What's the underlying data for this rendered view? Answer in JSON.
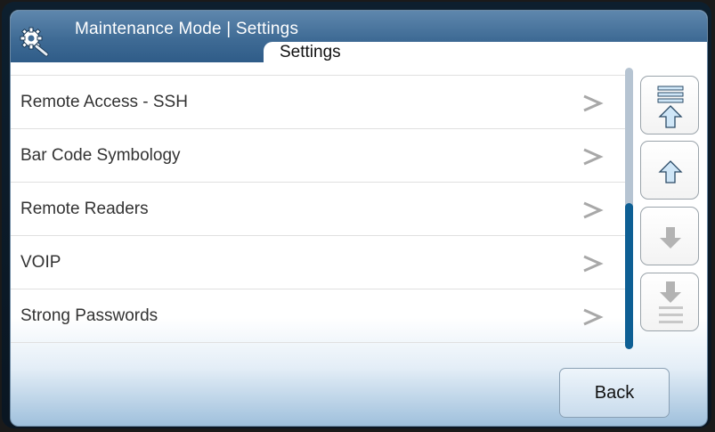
{
  "header": {
    "title": "Maintenance Mode | Settings",
    "tab_label": "Settings",
    "icon": "gear-wrench-icon"
  },
  "list": {
    "items": [
      {
        "label": "Remote Access - SSH",
        "icon": "chevron-right-icon"
      },
      {
        "label": "Bar Code Symbology",
        "icon": "chevron-right-icon"
      },
      {
        "label": "Remote Readers",
        "icon": "chevron-right-icon"
      },
      {
        "label": "VOIP",
        "icon": "chevron-right-icon"
      },
      {
        "label": "Strong Passwords",
        "icon": "chevron-right-icon"
      }
    ]
  },
  "scroll": {
    "position_fraction": 0.52,
    "buttons": [
      {
        "name": "scroll-top-button",
        "icon": "arrow-up-to-top-icon",
        "enabled": true
      },
      {
        "name": "scroll-up-button",
        "icon": "arrow-up-icon",
        "enabled": true
      },
      {
        "name": "scroll-down-button",
        "icon": "arrow-down-icon",
        "enabled": false
      },
      {
        "name": "scroll-bottom-button",
        "icon": "arrow-down-to-bottom-icon",
        "enabled": false
      }
    ]
  },
  "footer": {
    "back_label": "Back"
  },
  "colors": {
    "header": "#3f6b95",
    "scroll_thumb": "#0e5f94",
    "arrow_enabled": "#cfe6f7",
    "arrow_disabled": "#b3b3b3"
  }
}
